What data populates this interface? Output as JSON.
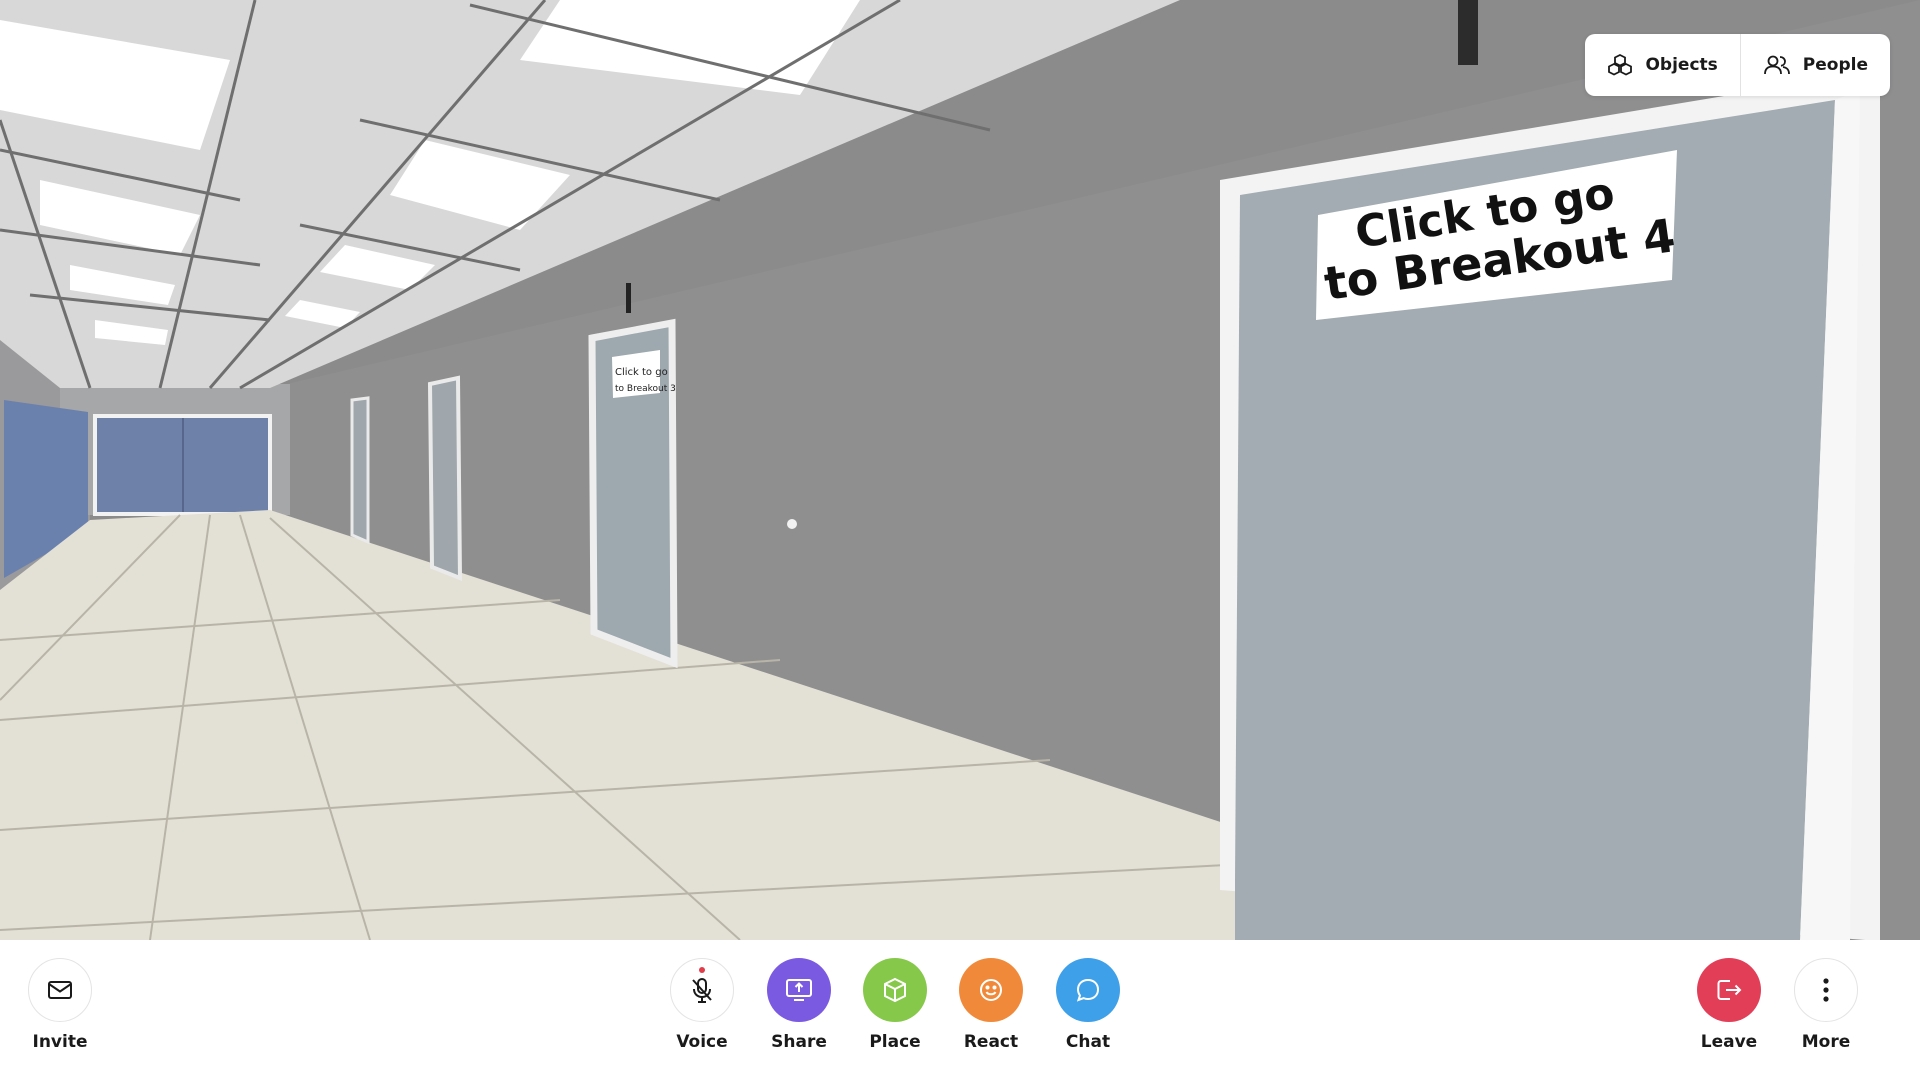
{
  "scene": {
    "near_door_sign_line1": "Click to go",
    "near_door_sign_line2": "to Breakout 4",
    "mid_door_sign_line1": "Click to go",
    "mid_door_sign_line2": "to Breakout 3"
  },
  "top_panel": {
    "objects_label": "Objects",
    "objects_icon": "cubes-icon",
    "people_label": "People",
    "people_icon": "people-icon"
  },
  "toolbar": {
    "invite": {
      "label": "Invite",
      "icon": "envelope-icon"
    },
    "voice": {
      "label": "Voice",
      "icon": "microphone-muted-icon",
      "state": "muted"
    },
    "share": {
      "label": "Share",
      "icon": "screen-share-icon",
      "color": "#7a5ae0"
    },
    "place": {
      "label": "Place",
      "icon": "cube-icon",
      "color": "#86c94a"
    },
    "react": {
      "label": "React",
      "icon": "smiley-icon",
      "color": "#f08a3a"
    },
    "chat": {
      "label": "Chat",
      "icon": "chat-bubble-icon",
      "color": "#3ea0e8"
    },
    "leave": {
      "label": "Leave",
      "icon": "exit-icon",
      "color": "#e23e58"
    },
    "more": {
      "label": "More",
      "icon": "vertical-dots-icon"
    }
  }
}
